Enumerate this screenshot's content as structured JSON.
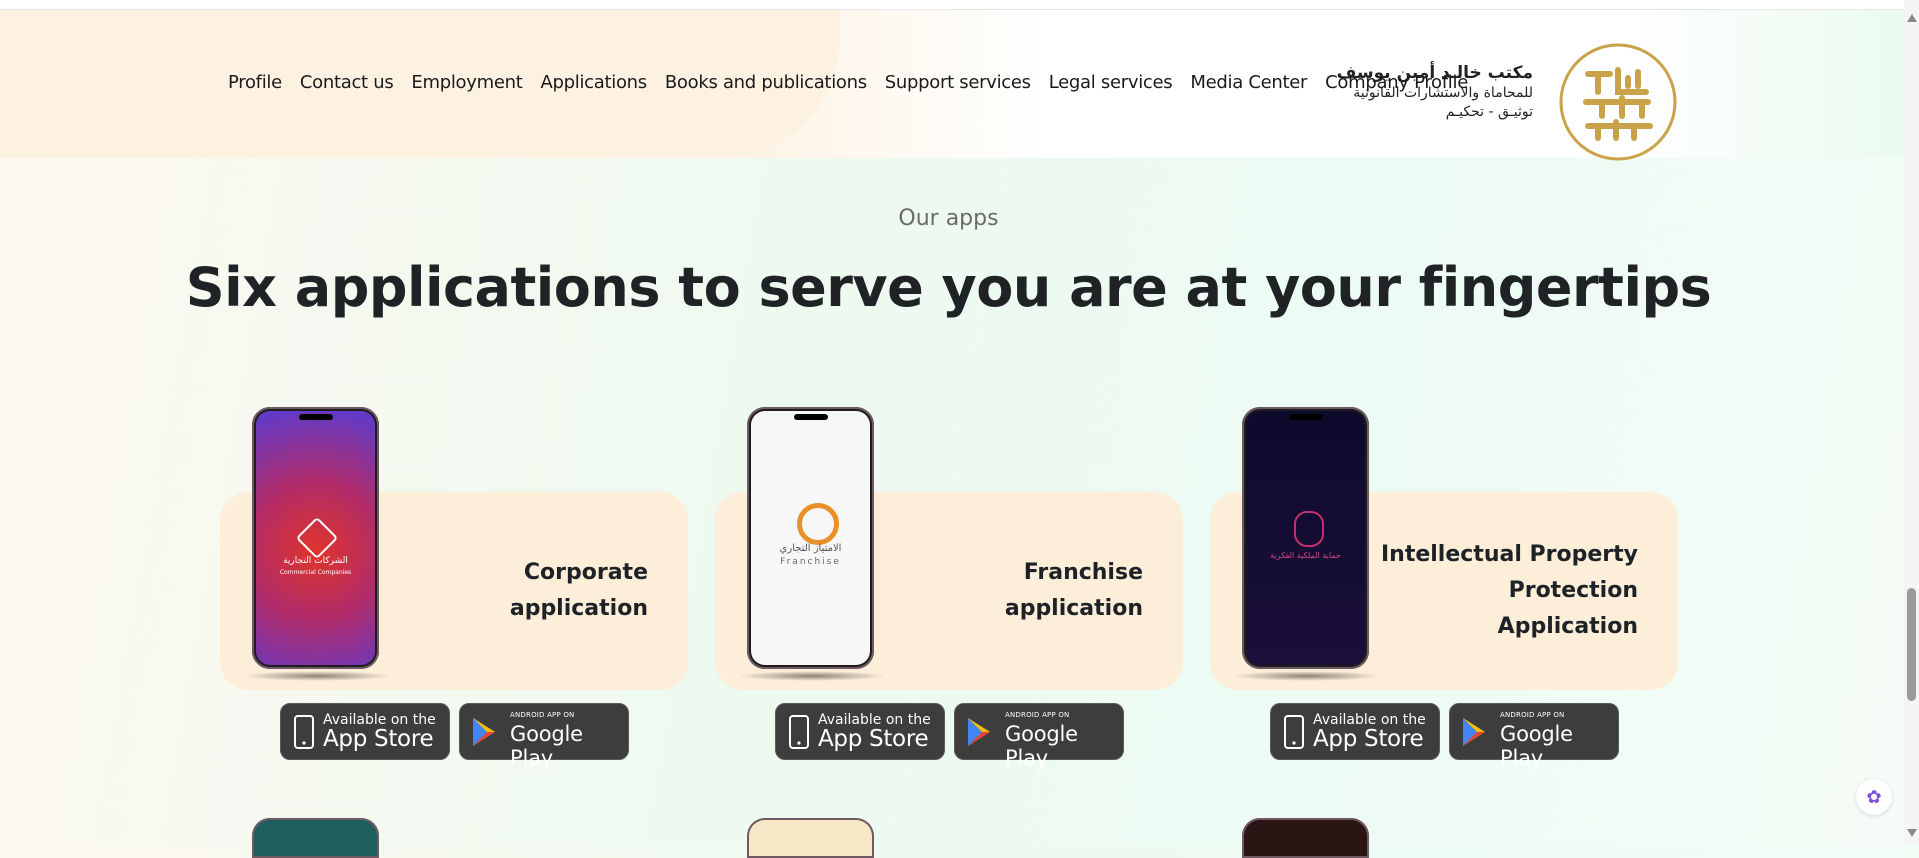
{
  "header": {
    "nav": [
      "Profile",
      "Contact us",
      "Employment",
      "Applications",
      "Books and publications",
      "Support services",
      "Legal services",
      "Media Center",
      "Company Profile"
    ],
    "brand": {
      "line1": "مكتب خالـد أمين يوسف",
      "line2": "للمحاماة والاستشارات القانونية",
      "line3": "توثيـق - تحكيـم"
    },
    "logo_icon": "khalid-yousef-logo"
  },
  "section": {
    "kicker": "Our apps",
    "headline": "Six applications to serve you are at your fingertips"
  },
  "apps": [
    {
      "title": "Corporate application",
      "screen_ar": "الشركات التجارية",
      "screen_en": "Commercial Companies",
      "color_top": "#5a3bd1",
      "color_bottom": "#e0342a"
    },
    {
      "title": "Franchise application",
      "screen_ar": "الامتياز التجاري",
      "screen_en": "Franchise",
      "color_top": "#ffffff",
      "color_bottom": "#f1f1f1"
    },
    {
      "title": "Intellectual Property Protection Application",
      "screen_ar": "حماية الملكية الفكرية",
      "screen_en": "",
      "color_top": "#0d0a2c",
      "color_bottom": "#1b0f3a"
    }
  ],
  "badges": {
    "appstore_small": "Available on the",
    "appstore_big": "App Store",
    "gplay_small": "ANDROID APP ON",
    "gplay_big": "Google Play"
  },
  "colors": {
    "card_bg": "#fdeeda",
    "badge_bg": "#3d3d3d",
    "logo_gold": "#c9a24a"
  }
}
